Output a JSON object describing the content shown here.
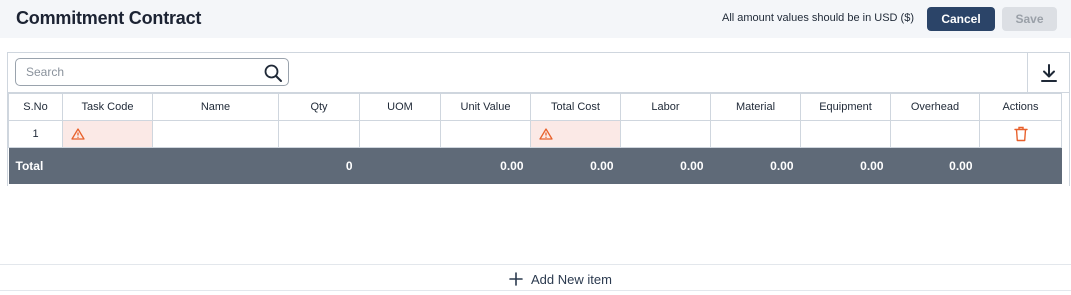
{
  "header": {
    "title": "Commitment Contract",
    "currency_note": "All amount values should be in USD ($)",
    "cancel_label": "Cancel",
    "save_label": "Save"
  },
  "search": {
    "placeholder": "Search",
    "value": ""
  },
  "table": {
    "columns": [
      "S.No",
      "Task Code",
      "Name",
      "Qty",
      "UOM",
      "Unit Value",
      "Total Cost",
      "Labor",
      "Material",
      "Equipment",
      "Overhead",
      "Actions"
    ],
    "rows": [
      {
        "sno": "1",
        "task_code": "",
        "name": "",
        "qty": "",
        "uom": "",
        "unit_value": "",
        "total_cost": "",
        "labor": "",
        "material": "",
        "equipment": "",
        "overhead": ""
      }
    ],
    "totals": {
      "label": "Total",
      "qty": "0",
      "unit_value": "0.00",
      "total_cost": "0.00",
      "labor": "0.00",
      "material": "0.00",
      "equipment": "0.00",
      "overhead": "0.00"
    }
  },
  "footer": {
    "add_label": "Add New item"
  },
  "colors": {
    "primary": "#2b4468",
    "disabled": "#dcdfe4",
    "error_cell": "#fbe9e6",
    "warning": "#e8612c",
    "total_row": "#5f6a78"
  }
}
